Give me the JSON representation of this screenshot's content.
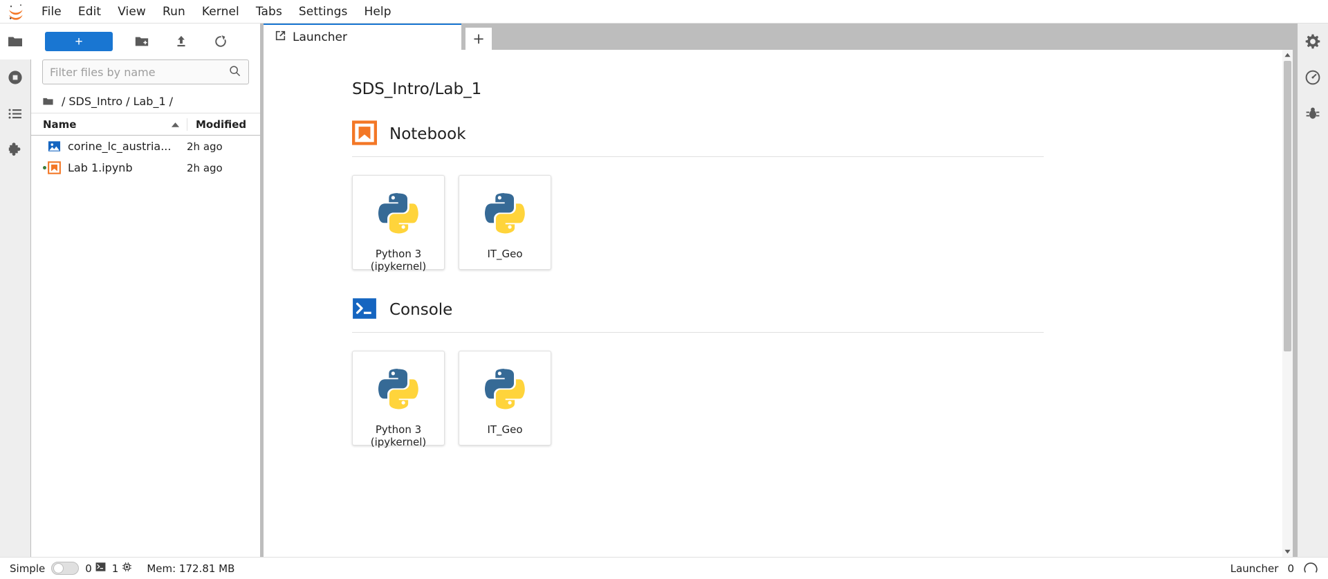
{
  "menubar": {
    "logo": "jupyter-logo",
    "items": [
      {
        "label": "File"
      },
      {
        "label": "Edit"
      },
      {
        "label": "View"
      },
      {
        "label": "Run"
      },
      {
        "label": "Kernel"
      },
      {
        "label": "Tabs"
      },
      {
        "label": "Settings"
      },
      {
        "label": "Help"
      }
    ]
  },
  "left_rail": {
    "items": [
      {
        "icon": "folder-icon",
        "name": "file-browser",
        "active": true
      },
      {
        "icon": "stop-circle-icon",
        "name": "running-terminals-and-kernels",
        "active": false
      },
      {
        "icon": "list-icon",
        "name": "command-palette",
        "active": false
      },
      {
        "icon": "puzzle-icon",
        "name": "extension-manager",
        "active": false
      }
    ]
  },
  "filebrowser": {
    "toolbar": {
      "new_launcher_label": "+",
      "new_folder_icon": "new-folder-icon",
      "upload_icon": "upload-icon",
      "refresh_icon": "refresh-icon"
    },
    "filter": {
      "placeholder": "Filter files by name",
      "value": "",
      "search_icon": "search-icon"
    },
    "breadcrumb": {
      "root_icon": "folder-icon",
      "parts": [
        "SDS_Intro",
        "Lab_1"
      ],
      "separator": "/"
    },
    "columns": {
      "name": "Name",
      "modified": "Modified",
      "sort_direction": "ascending"
    },
    "files": [
      {
        "name": "corine_lc_austria...",
        "modified": "2h ago",
        "icon": "image-file-icon",
        "running": false
      },
      {
        "name": "Lab 1.ipynb",
        "modified": "2h ago",
        "icon": "notebook-file-icon",
        "running": true
      }
    ]
  },
  "tabbar": {
    "tabs": [
      {
        "label": "Launcher",
        "icon": "launcher-icon",
        "active": true
      }
    ],
    "add_tab_label": "+"
  },
  "launcher": {
    "title": "SDS_Intro/Lab_1",
    "sections": [
      {
        "title": "Notebook",
        "icon": "notebook-section-icon",
        "cards": [
          {
            "label": "Python 3\n(ipykernel)",
            "icon": "python-logo"
          },
          {
            "label": "IT_Geo",
            "icon": "python-logo"
          }
        ]
      },
      {
        "title": "Console",
        "icon": "console-section-icon",
        "cards": [
          {
            "label": "Python 3\n(ipykernel)",
            "icon": "python-logo"
          },
          {
            "label": "IT_Geo",
            "icon": "python-logo"
          }
        ]
      }
    ]
  },
  "right_rail": {
    "items": [
      {
        "icon": "gear-icon",
        "name": "property-inspector"
      },
      {
        "icon": "gauge-icon",
        "name": "debugger-gauge"
      },
      {
        "icon": "bug-icon",
        "name": "debugger"
      }
    ]
  },
  "statusbar": {
    "mode_label": "Simple",
    "mode_enabled": false,
    "terminal_count": "0",
    "kernel_count": "1",
    "terminal_icon": "terminal-icon",
    "kernel_icon": "kernel-icon",
    "memory": "Mem: 172.81 MB",
    "active_tab": "Launcher",
    "busy_count": "0",
    "busy_icon": "idle-circle-icon"
  },
  "colors": {
    "accent_blue": "#1976d2",
    "jupyter_orange": "#f37726",
    "python_blue": "#366a96",
    "python_yellow": "#ffd43b",
    "running_green": "#3a7d3a",
    "chrome_gray": "#bdbdbd"
  }
}
